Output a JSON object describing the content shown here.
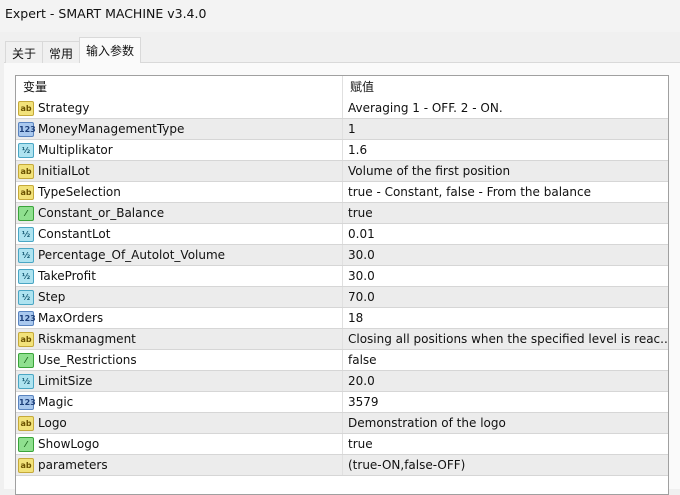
{
  "window": {
    "title": "Expert - SMART MACHINE v3.4.0"
  },
  "tabs": [
    {
      "label": "关于"
    },
    {
      "label": "常用"
    },
    {
      "label": "输入参数"
    }
  ],
  "table": {
    "headers": {
      "variable": "变量",
      "value": "赋值"
    },
    "rows": [
      {
        "icon": "string",
        "name": "Strategy",
        "value": "Averaging 1 - OFF. 2 - ON."
      },
      {
        "icon": "integer",
        "name": "MoneyManagementType",
        "value": "1"
      },
      {
        "icon": "double",
        "name": "Multiplikator",
        "value": "1.6"
      },
      {
        "icon": "string",
        "name": "InitialLot",
        "value": "Volume of the first position"
      },
      {
        "icon": "string",
        "name": "TypeSelection",
        "value": "true - Constant, false - From the balance"
      },
      {
        "icon": "bool",
        "name": "Constant_or_Balance",
        "value": "true"
      },
      {
        "icon": "double",
        "name": "ConstantLot",
        "value": "0.01"
      },
      {
        "icon": "double",
        "name": "Percentage_Of_Autolot_Volume",
        "value": "30.0"
      },
      {
        "icon": "double",
        "name": "TakeProfit",
        "value": "30.0"
      },
      {
        "icon": "double",
        "name": "Step",
        "value": "70.0"
      },
      {
        "icon": "integer",
        "name": "MaxOrders",
        "value": "18"
      },
      {
        "icon": "string",
        "name": "Riskmanagment",
        "value": "Closing all positions when the specified level is reac..."
      },
      {
        "icon": "bool",
        "name": "Use_Restrictions",
        "value": "false"
      },
      {
        "icon": "double",
        "name": "LimitSize",
        "value": "20.0"
      },
      {
        "icon": "integer",
        "name": "Magic",
        "value": "3579"
      },
      {
        "icon": "string",
        "name": "Logo",
        "value": "Demonstration of the logo"
      },
      {
        "icon": "bool",
        "name": "ShowLogo",
        "value": "true"
      },
      {
        "icon": "string",
        "name": "parameters",
        "value": "(true-ON,false-OFF)"
      }
    ]
  }
}
